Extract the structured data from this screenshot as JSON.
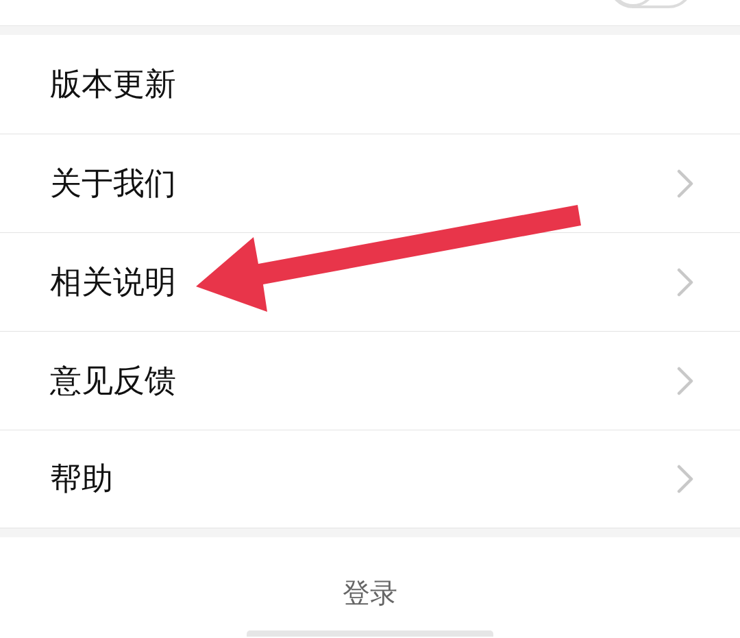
{
  "top_row": {
    "toggle": {
      "on": false
    }
  },
  "menu": [
    {
      "label": "版本更新",
      "has_chevron": false
    },
    {
      "label": "关于我们",
      "has_chevron": true
    },
    {
      "label": "相关说明",
      "has_chevron": true
    },
    {
      "label": "意见反馈",
      "has_chevron": true
    },
    {
      "label": "帮助",
      "has_chevron": true
    }
  ],
  "login_button": {
    "label": "登录"
  },
  "annotations": [
    {
      "kind": "arrow"
    }
  ]
}
